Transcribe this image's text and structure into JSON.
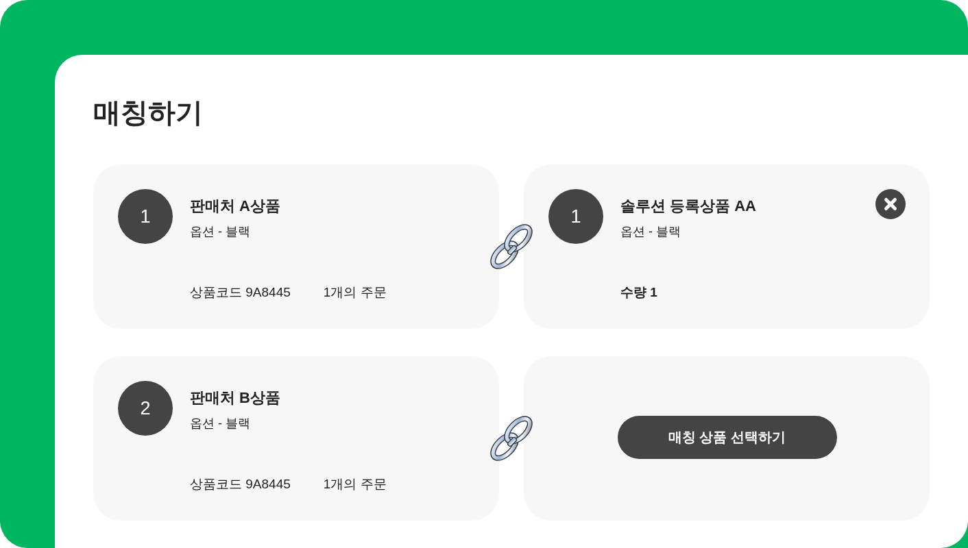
{
  "title": "매칭하기",
  "rows": [
    {
      "seller_item": {
        "number": "1",
        "name": "판매처 A상품",
        "option": "옵션 - 블랙",
        "product_code": "상품코드 9A8445",
        "orders": "1개의 주문"
      },
      "matched_item": {
        "kind": "matched",
        "number": "1",
        "name": "솔루션 등록상품 AA",
        "option": "옵션 - 블랙",
        "quantity": "수량 1"
      }
    },
    {
      "seller_item": {
        "number": "2",
        "name": "판매처 B상품",
        "option": "옵션 - 블랙",
        "product_code": "상품코드 9A8445",
        "orders": "1개의 주문"
      },
      "matched_item": {
        "kind": "empty",
        "button": "매칭 상품 선택하기"
      }
    }
  ]
}
